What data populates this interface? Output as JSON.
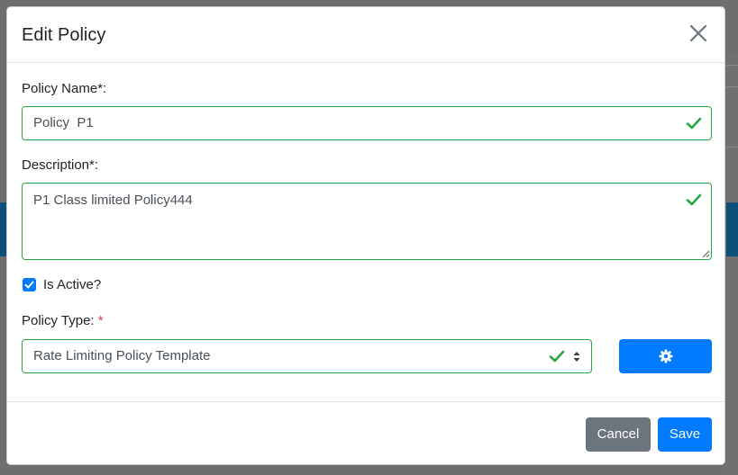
{
  "modal": {
    "title": "Edit Policy",
    "close_icon": "close-icon"
  },
  "form": {
    "policy_name": {
      "label": "Policy Name*:",
      "value": "Policy  P1",
      "status_icon": "check-icon"
    },
    "description": {
      "label": "Description*:",
      "value": "P1 Class limited Policy444",
      "status_icon": "check-icon"
    },
    "is_active": {
      "label": "Is Active?",
      "checked": true
    },
    "policy_type": {
      "label": "Policy Type: ",
      "required_marker": "*",
      "selected": "Rate Limiting Policy Template",
      "status_icon": "check-icon",
      "settings_icon": "gear-icon"
    }
  },
  "footer": {
    "cancel_label": "Cancel",
    "save_label": "Save"
  },
  "colors": {
    "primary": "#007bff",
    "secondary": "#6c757d",
    "valid": "#28a745",
    "required": "#dc3545"
  }
}
